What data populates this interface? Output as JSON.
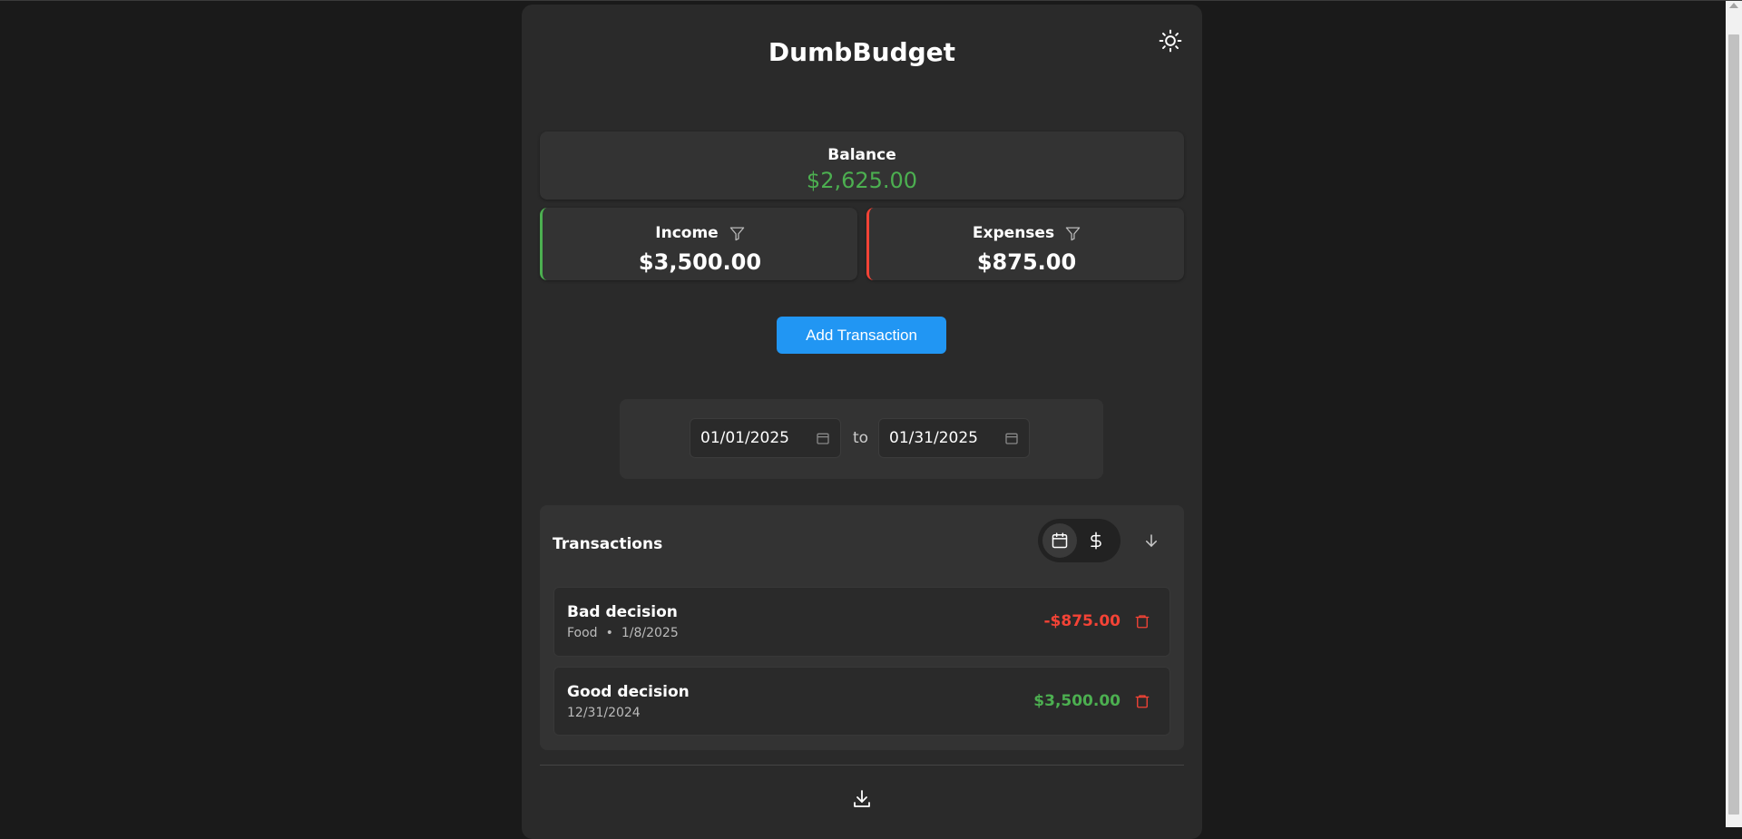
{
  "app": {
    "title": "DumbBudget",
    "theme_toggle_icon": "sun-icon"
  },
  "balance": {
    "label": "Balance",
    "value": "$2,625.00",
    "color": "#4caf50"
  },
  "income": {
    "label": "Income",
    "value": "$3,500.00",
    "accent": "#4caf50",
    "filter_icon": "filter-icon"
  },
  "expenses": {
    "label": "Expenses",
    "value": "$875.00",
    "accent": "#f44336",
    "filter_icon": "filter-icon"
  },
  "actions": {
    "add_transaction": "Add Transaction",
    "button_color": "#2196f3"
  },
  "date_range": {
    "from": "01/01/2025",
    "separator": "to",
    "to": "01/31/2025"
  },
  "transactions": {
    "title": "Transactions",
    "sort_options": [
      "calendar-icon",
      "dollar-icon"
    ],
    "sort_active": "calendar-icon",
    "sort_direction_icon": "arrow-down-icon",
    "items": [
      {
        "name": "Bad decision",
        "category": "Food",
        "date": "1/8/2025",
        "amount": "-$875.00",
        "type": "expense"
      },
      {
        "name": "Good decision",
        "date": "12/31/2024",
        "amount": "$3,500.00",
        "type": "income"
      }
    ]
  },
  "footer": {
    "export_icon": "download-icon"
  }
}
